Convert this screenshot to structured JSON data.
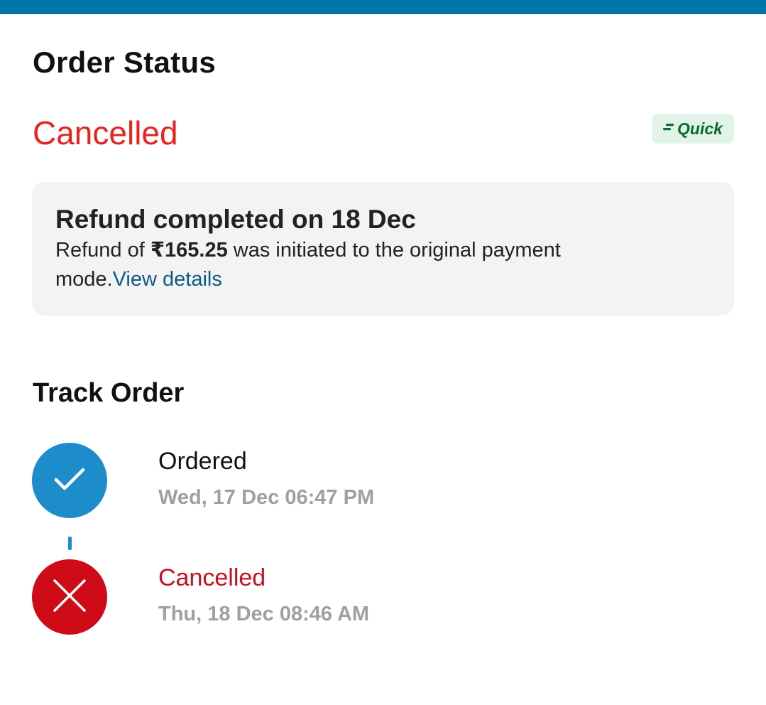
{
  "header": {
    "title": "Order Status"
  },
  "status": {
    "text": "Cancelled",
    "badge_label": "Quick"
  },
  "refund": {
    "title": "Refund completed on 18 Dec",
    "text_prefix": "Refund of ",
    "amount": "₹165.25",
    "text_suffix": " was initiated to the original payment mode.",
    "link_label": "View details"
  },
  "track": {
    "title": "Track Order",
    "steps": [
      {
        "label": "Ordered",
        "time": "Wed, 17 Dec 06:47 PM",
        "state": "done"
      },
      {
        "label": "Cancelled",
        "time": "Thu, 18 Dec 08:46 AM",
        "state": "cancelled"
      }
    ]
  },
  "colors": {
    "top_bar": "#0174a9",
    "cancelled_red": "#e8231f",
    "done_blue": "#1c8dca",
    "cancel_circle": "#cf0b18",
    "link_blue": "#0e5a85",
    "quick_green": "#0e6b2d",
    "quick_bg": "#e2f4ea"
  },
  "icons": {
    "quick_badge": "speed-lines-icon",
    "step_done": "check-icon",
    "step_cancelled": "close-icon"
  }
}
